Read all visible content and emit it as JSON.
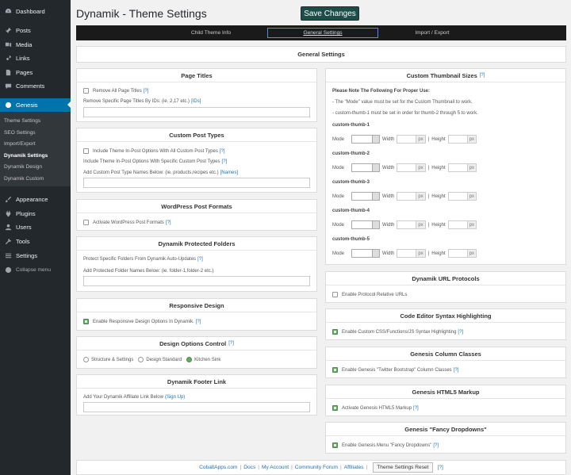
{
  "sidebar": {
    "items": [
      {
        "label": "Dashboard",
        "icon": "dashboard-icon"
      },
      {
        "label": "Posts",
        "icon": "pin-icon"
      },
      {
        "label": "Media",
        "icon": "media-icon"
      },
      {
        "label": "Links",
        "icon": "link-icon"
      },
      {
        "label": "Pages",
        "icon": "page-icon"
      },
      {
        "label": "Comments",
        "icon": "comment-icon"
      },
      {
        "label": "Genesis",
        "icon": "genesis-icon"
      },
      {
        "label": "Appearance",
        "icon": "brush-icon"
      },
      {
        "label": "Plugins",
        "icon": "plug-icon"
      },
      {
        "label": "Users",
        "icon": "user-icon"
      },
      {
        "label": "Tools",
        "icon": "wrench-icon"
      },
      {
        "label": "Settings",
        "icon": "settings-icon"
      },
      {
        "label": "Collapse menu",
        "icon": "collapse-icon"
      }
    ],
    "submenu": [
      "Theme Settings",
      "SEO Settings",
      "Import/Export",
      "Dynamik Settings",
      "Dynamik Design",
      "Dynamik Custom"
    ]
  },
  "header": {
    "title": "Dynamik - Theme Settings",
    "save_label": "Save Changes"
  },
  "tabs": [
    "Child Theme Info",
    "General Settings",
    "Import / Export"
  ],
  "general_header": "General Settings",
  "help": "[?]",
  "page_titles": {
    "title": "Page Titles",
    "remove_all": "Remove All Page Titles",
    "remove_specific": "Remove Specific Page Titles By IDs: (ie. 2,17 etc.)",
    "ids_link": "[IDs]"
  },
  "cpt": {
    "title": "Custom Post Types",
    "opt_all": "Include Theme In-Post Options With All Custom Post Types",
    "opt_specific": "Include Theme In-Post Options With Specific Custom Post Types",
    "names_label": "Add Custom Post Type Names Below: (ie. products,recipes etc.)",
    "names_link": "[Names]"
  },
  "formats": {
    "title": "WordPress Post Formats",
    "activate": "Activate WordPress Post Formats"
  },
  "protected": {
    "title": "Dynamik Protected Folders",
    "protect_label": "Protect Specific Folders From Dynamik Auto-Updates",
    "add_label": "Add Protected Folder Names Below: (ie. folder-1,folder-2 etc.)"
  },
  "responsive": {
    "title": "Responsive Design",
    "enable": "Enable Responsive Design Options In Dynamik."
  },
  "design_control": {
    "title": "Design Options Control",
    "options": [
      "Structure & Settings",
      "Design Standard",
      "Kitchen Sink"
    ],
    "selected": "Kitchen Sink"
  },
  "footer_link": {
    "title": "Dynamik Footer Link",
    "label": "Add Your Dynamik Affiliate Link Below",
    "link": "(Sign Up)"
  },
  "thumbs": {
    "title": "Custom Thumbnail Sizes",
    "note": "Please Note The Following For Proper Use:",
    "note1": "- The \"Mode\" value must be set for the Custom Thumbnail to work.",
    "note2": "- custom-thumb-1 must be set in order for thumb-2 through 5 to work.",
    "mode_label": "Mode",
    "width_label": "Width",
    "height_label": "Height",
    "unit": "px",
    "sep": "|",
    "items": [
      "custom-thumb-1",
      "custom-thumb-2",
      "custom-thumb-3",
      "custom-thumb-4",
      "custom-thumb-5"
    ]
  },
  "url_protocols": {
    "title": "Dynamik URL Protocols",
    "enable": "Enable Protocol Relative URLs"
  },
  "syntax": {
    "title": "Code Editor Syntax Highlighting",
    "enable": "Enable Custom CSS/Functions/JS Syntax Highlighting"
  },
  "column_classes": {
    "title": "Genesis Column Classes",
    "enable": "Enable Genesis \"Twitter Bootstrap\" Column Classes"
  },
  "html5": {
    "title": "Genesis HTML5 Markup",
    "enable": "Activate Genesis HTML5 Markup"
  },
  "dropdowns": {
    "title": "Genesis \"Fancy Dropdowns\"",
    "enable": "Enable Genesis Menu \"Fancy Dropdowns\""
  },
  "footer": {
    "links": [
      "CobaltApps.com",
      "Docs",
      "My Account",
      "Community Forum",
      "Affiliates"
    ],
    "reset_label": "Theme Settings Reset"
  }
}
